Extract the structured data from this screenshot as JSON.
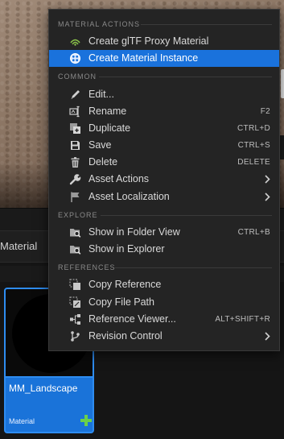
{
  "context_menu": {
    "sections": [
      {
        "header": "MATERIAL ACTIONS",
        "items": [
          {
            "label": "Create glTF Proxy Material",
            "icon": "gltf-icon"
          },
          {
            "label": "Create Material Instance",
            "icon": "material-instance-icon",
            "highlighted": true
          }
        ]
      },
      {
        "header": "COMMON",
        "items": [
          {
            "label": "Edit...",
            "icon": "pencil-icon"
          },
          {
            "label": "Rename",
            "icon": "rename-icon",
            "shortcut": "F2"
          },
          {
            "label": "Duplicate",
            "icon": "duplicate-icon",
            "shortcut": "CTRL+D"
          },
          {
            "label": "Save",
            "icon": "save-icon",
            "shortcut": "CTRL+S"
          },
          {
            "label": "Delete",
            "icon": "trash-icon",
            "shortcut": "DELETE"
          },
          {
            "label": "Asset Actions",
            "icon": "wrench-icon",
            "submenu": true
          },
          {
            "label": "Asset Localization",
            "icon": "flag-icon",
            "submenu": true
          }
        ]
      },
      {
        "header": "EXPLORE",
        "items": [
          {
            "label": "Show in Folder View",
            "icon": "folder-search-icon",
            "shortcut": "CTRL+B"
          },
          {
            "label": "Show in Explorer",
            "icon": "folder-search-icon"
          }
        ]
      },
      {
        "header": "REFERENCES",
        "items": [
          {
            "label": "Copy Reference",
            "icon": "copy-reference-icon"
          },
          {
            "label": "Copy File Path",
            "icon": "copy-path-icon"
          },
          {
            "label": "Reference Viewer...",
            "icon": "reference-viewer-icon",
            "shortcut": "ALT+SHIFT+R"
          },
          {
            "label": "Revision Control",
            "icon": "branch-icon",
            "submenu": true
          }
        ]
      }
    ]
  },
  "browser": {
    "tab_label": "Material"
  },
  "asset": {
    "name": "MM_Landscape",
    "type": "Material"
  },
  "colors": {
    "highlight": "#1a72dc",
    "asset_tile": "#1a73d9",
    "menu_bg": "#242424",
    "add_badge": "#6ad04a"
  }
}
